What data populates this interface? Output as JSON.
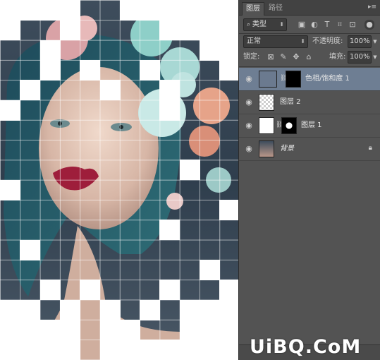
{
  "panel": {
    "tabs": [
      {
        "label": "图层",
        "active": true
      },
      {
        "label": "路径",
        "active": false
      }
    ],
    "menu_icon": "panel-menu-icon",
    "filter": {
      "value": "类型"
    },
    "blend_mode": {
      "value": "正常"
    },
    "opacity": {
      "label": "不透明度:",
      "value": "100%"
    },
    "lock": {
      "label": "锁定:"
    },
    "fill": {
      "label": "填充:",
      "value": "100%"
    },
    "layers": [
      {
        "name": "色相/饱和度 1",
        "selected": true,
        "visible": true
      },
      {
        "name": "图层 2",
        "selected": false,
        "visible": true
      },
      {
        "name": "图层 1",
        "selected": false,
        "visible": true
      },
      {
        "name": "背景",
        "selected": false,
        "visible": true,
        "locked": true
      }
    ]
  },
  "watermark": {
    "text": "UiBQ.CoM"
  },
  "colors": {
    "panel_bg": "#535353",
    "selected_layer": "#6e7e93",
    "canvas_bg": "#ffffff"
  }
}
